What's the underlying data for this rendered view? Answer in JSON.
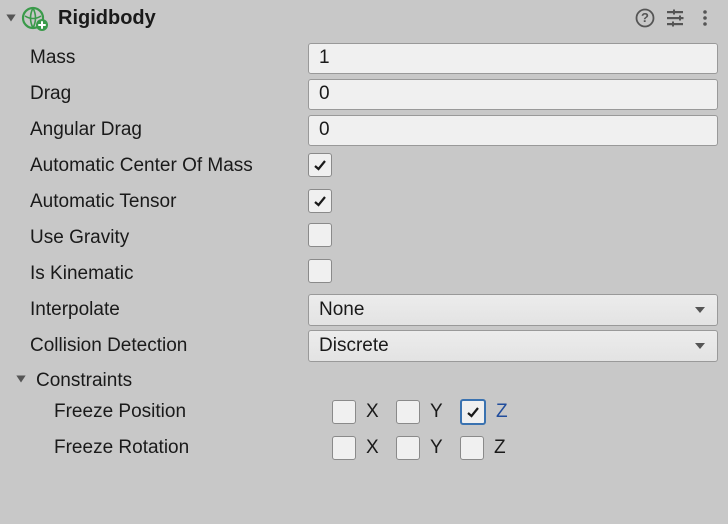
{
  "header": {
    "title": "Rigidbody"
  },
  "sectionConstraints": "Constraints",
  "rows": {
    "mass": {
      "label": "Mass",
      "value": "1"
    },
    "drag": {
      "label": "Drag",
      "value": "0"
    },
    "angularDrag": {
      "label": "Angular Drag",
      "value": "0"
    },
    "autoCenter": {
      "label": "Automatic Center Of Mass",
      "checked": true
    },
    "autoTensor": {
      "label": "Automatic Tensor",
      "checked": true
    },
    "useGravity": {
      "label": "Use Gravity",
      "checked": false
    },
    "isKinematic": {
      "label": "Is Kinematic",
      "checked": false
    },
    "interpolate": {
      "label": "Interpolate",
      "value": "None"
    },
    "collision": {
      "label": "Collision Detection",
      "value": "Discrete"
    },
    "freezePos": {
      "label": "Freeze Position",
      "x": false,
      "y": false,
      "z": true,
      "xl": "X",
      "yl": "Y",
      "zl": "Z"
    },
    "freezeRot": {
      "label": "Freeze Rotation",
      "x": false,
      "y": false,
      "z": false,
      "xl": "X",
      "yl": "Y",
      "zl": "Z"
    }
  }
}
